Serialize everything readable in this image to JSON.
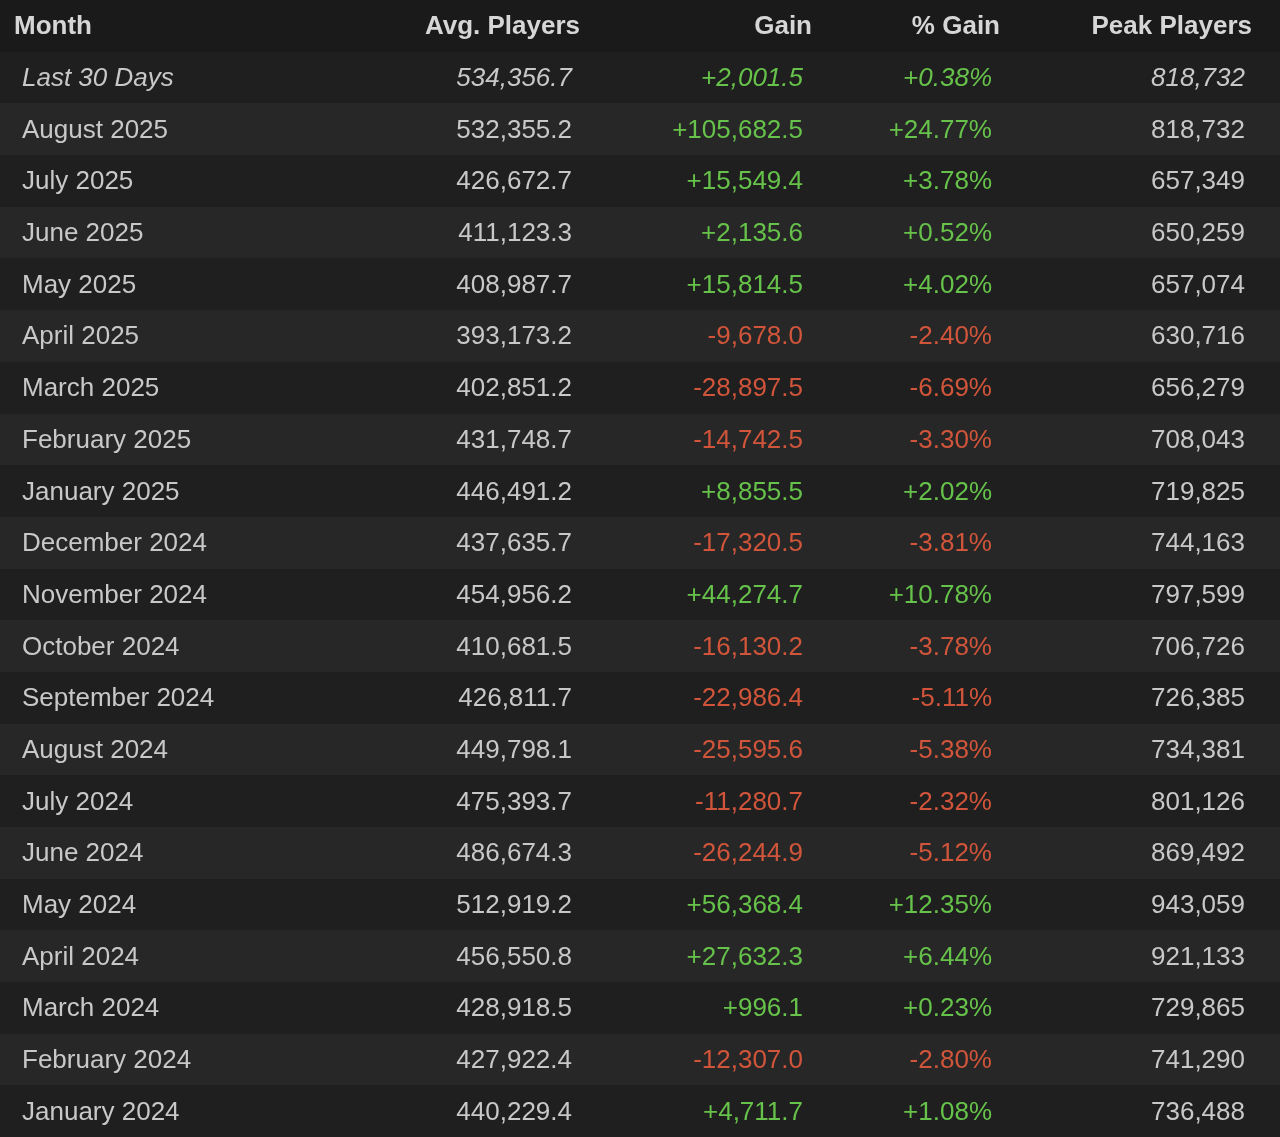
{
  "table": {
    "columns": [
      "Month",
      "Avg. Players",
      "Gain",
      "% Gain",
      "Peak Players"
    ],
    "rows": [
      {
        "kind": "recent",
        "month": "Last 30 Days",
        "avg": "534,356.7",
        "gain": "+2,001.5",
        "pct": "+0.38%",
        "peak": "818,732",
        "color": "#66c24a"
      },
      {
        "kind": "month",
        "month": "August 2025",
        "avg": "532,355.2",
        "gain": "+105,682.5",
        "pct": "+24.77%",
        "peak": "818,732",
        "color": "#66c24a"
      },
      {
        "kind": "month",
        "month": "July 2025",
        "avg": "426,672.7",
        "gain": "+15,549.4",
        "pct": "+3.78%",
        "peak": "657,349",
        "color": "#66c24a"
      },
      {
        "kind": "month",
        "month": "June 2025",
        "avg": "411,123.3",
        "gain": "+2,135.6",
        "pct": "+0.52%",
        "peak": "650,259",
        "color": "#66c24a"
      },
      {
        "kind": "month",
        "month": "May 2025",
        "avg": "408,987.7",
        "gain": "+15,814.5",
        "pct": "+4.02%",
        "peak": "657,074",
        "color": "#66c24a"
      },
      {
        "kind": "month",
        "month": "April 2025",
        "avg": "393,173.2",
        "gain": "-9,678.0",
        "pct": "-2.40%",
        "peak": "630,716",
        "color": "#d0553a"
      },
      {
        "kind": "month",
        "month": "March 2025",
        "avg": "402,851.2",
        "gain": "-28,897.5",
        "pct": "-6.69%",
        "peak": "656,279",
        "color": "#d0553a"
      },
      {
        "kind": "month",
        "month": "February 2025",
        "avg": "431,748.7",
        "gain": "-14,742.5",
        "pct": "-3.30%",
        "peak": "708,043",
        "color": "#d0553a"
      },
      {
        "kind": "month",
        "month": "January 2025",
        "avg": "446,491.2",
        "gain": "+8,855.5",
        "pct": "+2.02%",
        "peak": "719,825",
        "color": "#66c24a"
      },
      {
        "kind": "month",
        "month": "December 2024",
        "avg": "437,635.7",
        "gain": "-17,320.5",
        "pct": "-3.81%",
        "peak": "744,163",
        "color": "#d0553a"
      },
      {
        "kind": "month",
        "month": "November 2024",
        "avg": "454,956.2",
        "gain": "+44,274.7",
        "pct": "+10.78%",
        "peak": "797,599",
        "color": "#66c24a"
      },
      {
        "kind": "month",
        "month": "October 2024",
        "avg": "410,681.5",
        "gain": "-16,130.2",
        "pct": "-3.78%",
        "peak": "706,726",
        "color": "#d0553a"
      },
      {
        "kind": "month",
        "month": "September 2024",
        "avg": "426,811.7",
        "gain": "-22,986.4",
        "pct": "-5.11%",
        "peak": "726,385",
        "color": "#d0553a"
      },
      {
        "kind": "month",
        "month": "August 2024",
        "avg": "449,798.1",
        "gain": "-25,595.6",
        "pct": "-5.38%",
        "peak": "734,381",
        "color": "#d0553a"
      },
      {
        "kind": "month",
        "month": "July 2024",
        "avg": "475,393.7",
        "gain": "-11,280.7",
        "pct": "-2.32%",
        "peak": "801,126",
        "color": "#d0553a"
      },
      {
        "kind": "month",
        "month": "June 2024",
        "avg": "486,674.3",
        "gain": "-26,244.9",
        "pct": "-5.12%",
        "peak": "869,492",
        "color": "#d0553a"
      },
      {
        "kind": "month",
        "month": "May 2024",
        "avg": "512,919.2",
        "gain": "+56,368.4",
        "pct": "+12.35%",
        "peak": "943,059",
        "color": "#66c24a"
      },
      {
        "kind": "month",
        "month": "April 2024",
        "avg": "456,550.8",
        "gain": "+27,632.3",
        "pct": "+6.44%",
        "peak": "921,133",
        "color": "#66c24a"
      },
      {
        "kind": "month",
        "month": "March 2024",
        "avg": "428,918.5",
        "gain": "+996.1",
        "pct": "+0.23%",
        "peak": "729,865",
        "color": "#66c24a"
      },
      {
        "kind": "month",
        "month": "February 2024",
        "avg": "427,922.4",
        "gain": "-12,307.0",
        "pct": "-2.80%",
        "peak": "741,290",
        "color": "#d0553a"
      },
      {
        "kind": "month",
        "month": "January 2024",
        "avg": "440,229.4",
        "gain": "+4,711.7",
        "pct": "+1.08%",
        "peak": "736,488",
        "color": "#66c24a"
      }
    ]
  }
}
